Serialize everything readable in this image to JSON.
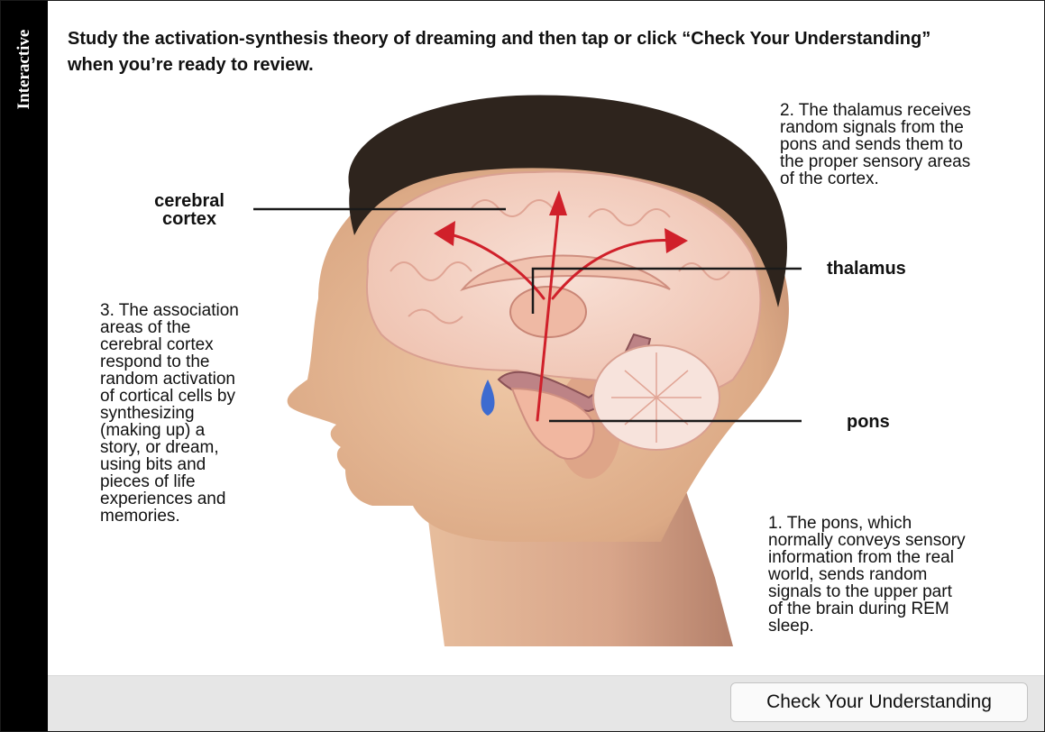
{
  "sidebar": {
    "label": "Interactive"
  },
  "instructions": "Study the activation-synthesis theory of dreaming and then tap or click “Check Your Understanding” when you’re ready to review.",
  "labels": {
    "cerebral_cortex": [
      "cerebral",
      "cortex"
    ],
    "thalamus": "thalamus",
    "pons": "pons"
  },
  "steps": {
    "step1": [
      "1. The pons, which",
      "normally conveys sensory",
      "information from the real",
      "world, sends random",
      "signals to the upper part",
      "of the brain during REM",
      "sleep."
    ],
    "step2": [
      "2. The thalamus receives",
      "random signals from the",
      "pons and sends them to",
      "the proper sensory areas",
      "of the cortex."
    ],
    "step3": [
      "3. The association",
      "areas of the",
      "cerebral cortex",
      "respond to the",
      "random activation",
      "of cortical cells by",
      "synthesizing",
      "(making up) a",
      "story, or dream,",
      "using bits and",
      "pieces of life",
      "experiences and",
      "memories."
    ]
  },
  "footer": {
    "button_label": "Check Your Understanding"
  },
  "colors": {
    "arrow": "#d0202a",
    "sidebar": "#000000",
    "footer_bg": "#e6e6e6",
    "hair": "#2e241d",
    "skin": "#e4b896",
    "brain": "#f3cdbf"
  }
}
